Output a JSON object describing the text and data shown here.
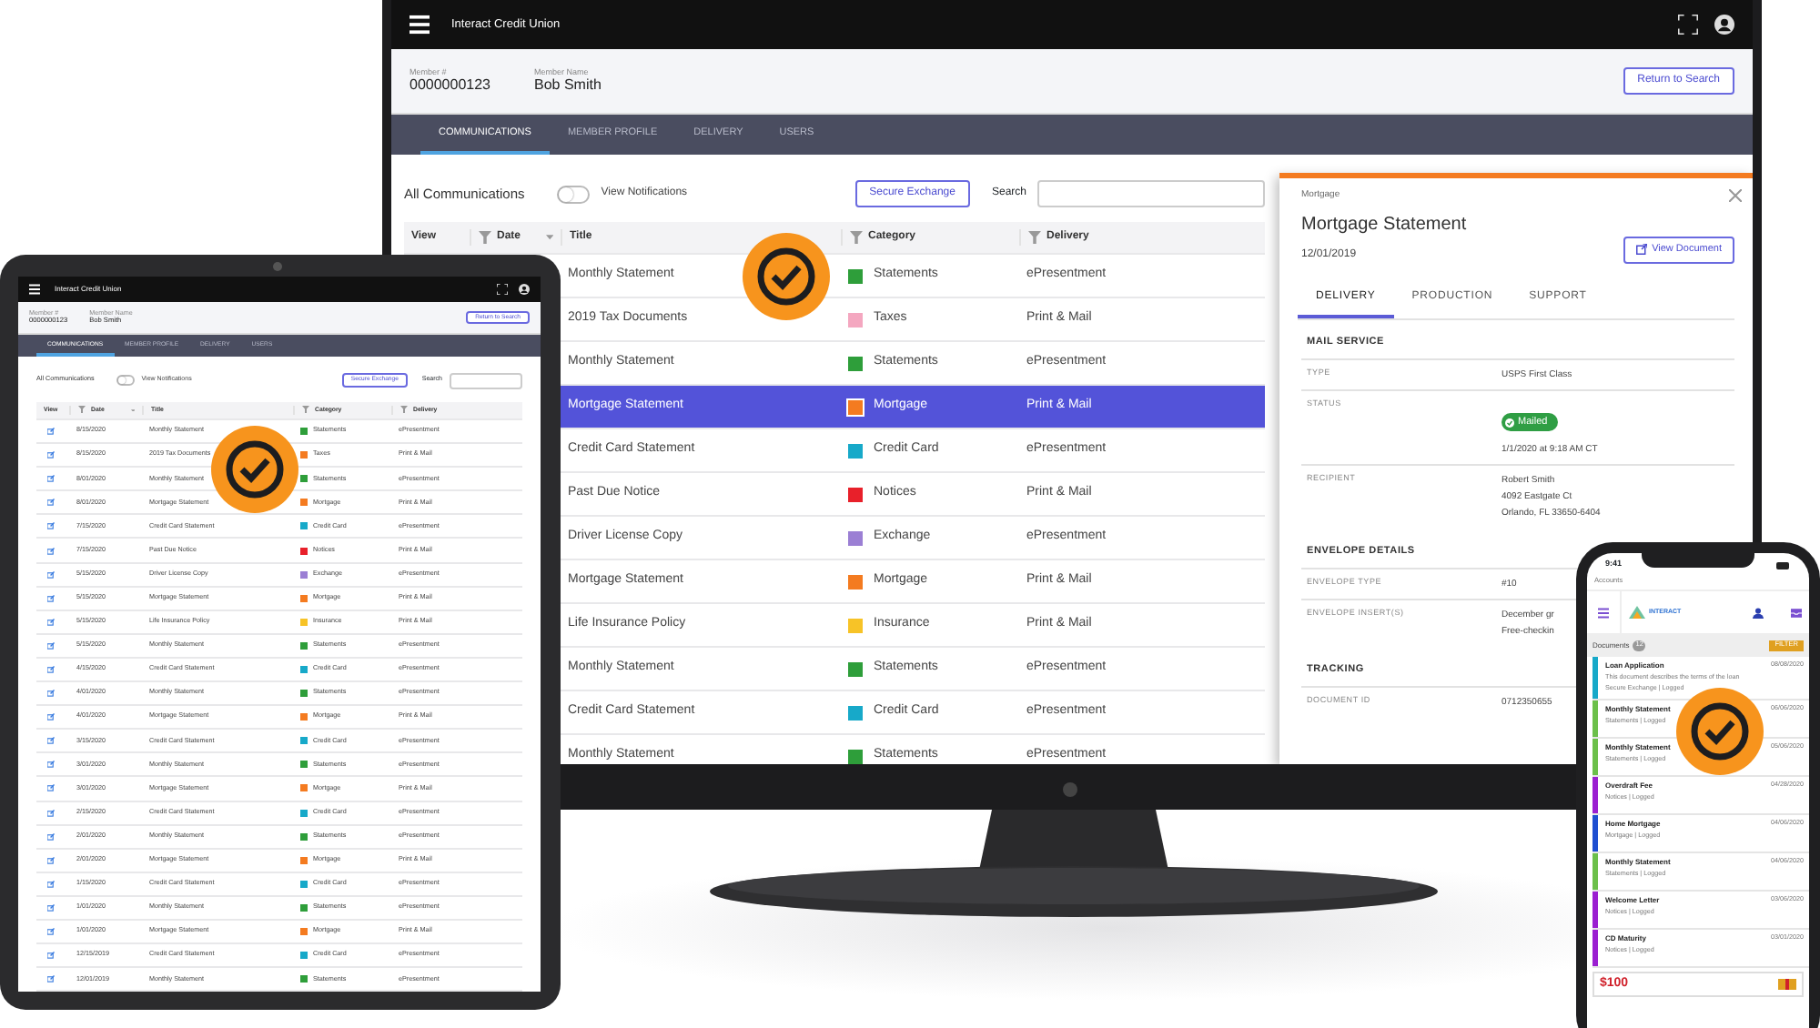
{
  "desktop": {
    "app_title": "Interact Credit Union",
    "member": [
      {
        "label": "Member #",
        "value": "0000000123"
      },
      {
        "label": "Member Name",
        "value": "Bob Smith"
      }
    ],
    "return_button": "Return to Search",
    "tabs": [
      {
        "label": "COMMUNICATIONS",
        "selected": true
      },
      {
        "label": "MEMBER PROFILE",
        "selected": false
      },
      {
        "label": "DELIVERY",
        "selected": false
      },
      {
        "label": "USERS",
        "selected": false
      }
    ],
    "list_title": "All Communications",
    "notifications_toggle": {
      "label": "View Notifications",
      "on": false
    },
    "secure_button": "Secure Exchange",
    "search_label": "Search",
    "columns": [
      "View",
      "Date",
      "Title",
      "Category",
      "Delivery"
    ],
    "rows": [
      {
        "title": "Monthly Statement",
        "category": "Statements",
        "color": "#2e9e3a",
        "delivery": "ePresentment",
        "selected": false
      },
      {
        "title": "2019 Tax Documents",
        "category": "Taxes",
        "color": "#f4a7c0",
        "delivery": "Print & Mail",
        "selected": false
      },
      {
        "title": "Monthly Statement",
        "category": "Statements",
        "color": "#2e9e3a",
        "delivery": "ePresentment",
        "selected": false
      },
      {
        "title": "Mortgage Statement",
        "category": "Mortgage",
        "color": "#f47b20",
        "delivery": "Print & Mail",
        "selected": true
      },
      {
        "title": "Credit Card Statement",
        "category": "Credit Card",
        "color": "#17a9c9",
        "delivery": "ePresentment",
        "selected": false
      },
      {
        "title": "Past Due Notice",
        "category": "Notices",
        "color": "#e8202a",
        "delivery": "Print & Mail",
        "selected": false
      },
      {
        "title": "Driver License Copy",
        "category": "Exchange",
        "color": "#9b7fd4",
        "delivery": "ePresentment",
        "selected": false
      },
      {
        "title": "Mortgage Statement",
        "category": "Mortgage",
        "color": "#f47b20",
        "delivery": "Print & Mail",
        "selected": false
      },
      {
        "title": "Life Insurance Policy",
        "category": "Insurance",
        "color": "#f7c327",
        "delivery": "Print & Mail",
        "selected": false
      },
      {
        "title": "Monthly Statement",
        "category": "Statements",
        "color": "#2e9e3a",
        "delivery": "ePresentment",
        "selected": false
      },
      {
        "title": "Credit Card Statement",
        "category": "Credit Card",
        "color": "#17a9c9",
        "delivery": "ePresentment",
        "selected": false
      },
      {
        "title": "Monthly Statement",
        "category": "Statements",
        "color": "#2e9e3a",
        "delivery": "ePresentment",
        "selected": false
      }
    ],
    "detail": {
      "category": "Mortgage",
      "title": "Mortgage Statement",
      "date": "12/01/2019",
      "view_button": "View Document",
      "tabs": [
        {
          "label": "DELIVERY",
          "selected": true
        },
        {
          "label": "PRODUCTION",
          "selected": false
        },
        {
          "label": "SUPPORT",
          "selected": false
        }
      ],
      "sections": [
        {
          "heading": "MAIL SERVICE",
          "fields": [
            {
              "label": "TYPE",
              "lines": [
                "USPS First Class"
              ]
            },
            {
              "label": "STATUS",
              "badge": "Mailed",
              "lines": [
                "1/1/2020 at 9:18 AM CT"
              ]
            },
            {
              "label": "RECIPIENT",
              "lines": [
                "Robert Smith",
                "4092 Eastgate Ct",
                "Orlando, FL 33650-6404"
              ]
            }
          ]
        },
        {
          "heading": "ENVELOPE DETAILS",
          "fields": [
            {
              "label": "ENVELOPE TYPE",
              "lines": [
                "#10"
              ]
            },
            {
              "label": "ENVELOPE INSERT(S)",
              "lines": [
                "December gr",
                "Free-checkin"
              ]
            }
          ]
        },
        {
          "heading": "TRACKING",
          "fields": [
            {
              "label": "DOCUMENT ID",
              "lines": [
                "0712350655"
              ]
            }
          ]
        }
      ]
    }
  },
  "tablet": {
    "app_title": "Interact Credit Union",
    "member": [
      {
        "label": "Member #",
        "value": "0000000123"
      },
      {
        "label": "Member Name",
        "value": "Bob Smith"
      }
    ],
    "return_button": "Return to Search",
    "tabs": [
      {
        "label": "COMMUNICATIONS",
        "selected": true
      },
      {
        "label": "MEMBER PROFILE",
        "selected": false
      },
      {
        "label": "DELIVERY",
        "selected": false
      },
      {
        "label": "USERS",
        "selected": false
      }
    ],
    "list_title": "All Communications",
    "notifications_toggle": {
      "label": "View Notifications",
      "on": false
    },
    "secure_button": "Secure Exchange",
    "search_label": "Search",
    "columns": [
      "View",
      "Date",
      "Title",
      "Category",
      "Delivery"
    ],
    "rows": [
      {
        "date": "8/15/2020",
        "title": "Monthly Statement",
        "category": "Statements",
        "color": "#2e9e3a",
        "delivery": "ePresentment"
      },
      {
        "date": "8/15/2020",
        "title": "2019 Tax Documents",
        "category": "Taxes",
        "color": "#f47b20",
        "delivery": "Print & Mail"
      },
      {
        "date": "8/01/2020",
        "title": "Monthly Statement",
        "category": "Statements",
        "color": "#2e9e3a",
        "delivery": "ePresentment"
      },
      {
        "date": "8/01/2020",
        "title": "Mortgage Statement",
        "category": "Mortgage",
        "color": "#f47b20",
        "delivery": "Print & Mail"
      },
      {
        "date": "7/15/2020",
        "title": "Credit Card Statement",
        "category": "Credit Card",
        "color": "#17a9c9",
        "delivery": "ePresentment"
      },
      {
        "date": "7/15/2020",
        "title": "Past Due Notice",
        "category": "Notices",
        "color": "#e8202a",
        "delivery": "Print & Mail"
      },
      {
        "date": "5/15/2020",
        "title": "Driver License Copy",
        "category": "Exchange",
        "color": "#9b7fd4",
        "delivery": "ePresentment"
      },
      {
        "date": "5/15/2020",
        "title": "Mortgage Statement",
        "category": "Mortgage",
        "color": "#f47b20",
        "delivery": "Print & Mail"
      },
      {
        "date": "5/15/2020",
        "title": "Life Insurance Policy",
        "category": "Insurance",
        "color": "#f7c327",
        "delivery": "Print & Mail"
      },
      {
        "date": "5/15/2020",
        "title": "Monthly Statement",
        "category": "Statements",
        "color": "#2e9e3a",
        "delivery": "ePresentment"
      },
      {
        "date": "4/15/2020",
        "title": "Credit Card Statement",
        "category": "Credit Card",
        "color": "#17a9c9",
        "delivery": "ePresentment"
      },
      {
        "date": "4/01/2020",
        "title": "Monthly Statement",
        "category": "Statements",
        "color": "#2e9e3a",
        "delivery": "ePresentment"
      },
      {
        "date": "4/01/2020",
        "title": "Mortgage Statement",
        "category": "Mortgage",
        "color": "#f47b20",
        "delivery": "Print & Mail"
      },
      {
        "date": "3/15/2020",
        "title": "Credit Card Statement",
        "category": "Credit Card",
        "color": "#17a9c9",
        "delivery": "ePresentment"
      },
      {
        "date": "3/01/2020",
        "title": "Monthly Statement",
        "category": "Statements",
        "color": "#2e9e3a",
        "delivery": "ePresentment"
      },
      {
        "date": "3/01/2020",
        "title": "Mortgage Statement",
        "category": "Mortgage",
        "color": "#f47b20",
        "delivery": "Print & Mail"
      },
      {
        "date": "2/15/2020",
        "title": "Credit Card Statement",
        "category": "Credit Card",
        "color": "#17a9c9",
        "delivery": "ePresentment"
      },
      {
        "date": "2/01/2020",
        "title": "Monthly Statement",
        "category": "Statements",
        "color": "#2e9e3a",
        "delivery": "ePresentment"
      },
      {
        "date": "2/01/2020",
        "title": "Mortgage Statement",
        "category": "Mortgage",
        "color": "#f47b20",
        "delivery": "Print & Mail"
      },
      {
        "date": "1/15/2020",
        "title": "Credit Card Statement",
        "category": "Credit Card",
        "color": "#17a9c9",
        "delivery": "ePresentment"
      },
      {
        "date": "1/01/2020",
        "title": "Monthly Statement",
        "category": "Statements",
        "color": "#2e9e3a",
        "delivery": "ePresentment"
      },
      {
        "date": "1/01/2020",
        "title": "Mortgage Statement",
        "category": "Mortgage",
        "color": "#f47b20",
        "delivery": "Print & Mail"
      },
      {
        "date": "12/15/2019",
        "title": "Credit Card Statement",
        "category": "Credit Card",
        "color": "#17a9c9",
        "delivery": "ePresentment"
      },
      {
        "date": "12/01/2019",
        "title": "Monthly Statement",
        "category": "Statements",
        "color": "#2e9e3a",
        "delivery": "ePresentment"
      }
    ]
  },
  "phone": {
    "time": "9:41",
    "breadcrumb": "Accounts",
    "logo_text": "INTERACT",
    "documents_label": "Documents",
    "documents_count": "12",
    "filter_button": "FILTER",
    "items": [
      {
        "title": "Loan Application",
        "date": "08/08/2020",
        "lines": [
          "This document describes the terms of the loan",
          "Secure Exchange | Logged"
        ],
        "color": "#17a9c9"
      },
      {
        "title": "Monthly Statement",
        "date": "06/06/2020",
        "lines": [
          "Statements | Logged"
        ],
        "color": "#6cc04a"
      },
      {
        "title": "Monthly Statement",
        "date": "05/06/2020",
        "lines": [
          "Statements | Logged"
        ],
        "color": "#6cc04a"
      },
      {
        "title": "Overdraft Fee",
        "date": "04/28/2020",
        "lines": [
          "Notices | Logged"
        ],
        "color": "#9b1fd1"
      },
      {
        "title": "Home Mortgage",
        "date": "04/06/2020",
        "lines": [
          "Mortgage | Logged"
        ],
        "color": "#1f4fd1"
      },
      {
        "title": "Monthly Statement",
        "date": "04/06/2020",
        "lines": [
          "Statements | Logged"
        ],
        "color": "#6cc04a"
      },
      {
        "title": "Welcome Letter",
        "date": "03/06/2020",
        "lines": [
          "Notices | Logged"
        ],
        "color": "#9b1fd1"
      },
      {
        "title": "CD Maturity",
        "date": "03/01/2020",
        "lines": [
          "Notices | Logged"
        ],
        "color": "#9b1fd1"
      }
    ],
    "ad_text": "$100"
  }
}
